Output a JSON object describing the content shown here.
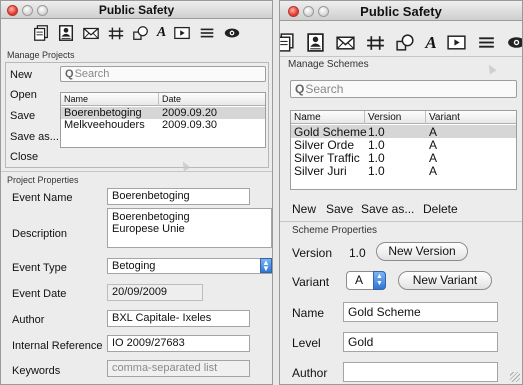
{
  "left_window": {
    "title": "Public Safety",
    "toolbar": [
      {
        "icon": "document-stack-icon"
      },
      {
        "icon": "contact-card-icon"
      },
      {
        "icon": "envelope-icon"
      },
      {
        "icon": "route-icon"
      },
      {
        "icon": "lasso-icon"
      },
      {
        "icon": "text-tool-icon",
        "glyph": "A"
      },
      {
        "icon": "play-box-icon"
      },
      {
        "icon": "list-icon"
      },
      {
        "icon": "eye-icon"
      }
    ],
    "manage_projects": {
      "label": "Manage Projects",
      "buttons": {
        "new": "New",
        "open": "Open",
        "save": "Save",
        "save_as": "Save as...",
        "close": "Close"
      },
      "search_placeholder": "Search",
      "columns": [
        "Name",
        "Date"
      ],
      "rows": [
        {
          "name": "Boerenbetoging",
          "date": "2009.09.20",
          "selected": true
        },
        {
          "name": "Melkveehouders",
          "date": "2009.09.30",
          "selected": false
        }
      ]
    },
    "project_properties": {
      "label": "Project Properties",
      "event_name_label": "Event Name",
      "event_name": "Boerenbetoging",
      "description_label": "Description",
      "description_line1": "Boerenbetoging",
      "description_line2": "Europese Unie",
      "event_type_label": "Event Type",
      "event_type": "Betoging",
      "event_date_label": "Event Date",
      "event_date": "20/09/2009",
      "author_label": "Author",
      "author": "BXL Capitale- Ixeles",
      "internal_reference_label": "Internal Reference",
      "internal_reference": "IO 2009/27683",
      "keywords_label": "Keywords",
      "keywords_placeholder": "comma-separated list"
    }
  },
  "right_window": {
    "title": "Public Safety",
    "manage_schemes": {
      "label": "Manage Schemes",
      "search_placeholder": "Search",
      "columns": [
        "Name",
        "Version",
        "Variant"
      ],
      "rows": [
        {
          "name": "Gold Scheme",
          "version": "1.0",
          "variant": "A",
          "selected": true
        },
        {
          "name": "Silver Orde",
          "version": "1.0",
          "variant": "A",
          "selected": false
        },
        {
          "name": "Silver Traffic",
          "version": "1.0",
          "variant": "A",
          "selected": false
        },
        {
          "name": "Silver Juri",
          "version": "1.0",
          "variant": "A",
          "selected": false
        }
      ],
      "buttons": {
        "new": "New",
        "save": "Save",
        "save_as": "Save as...",
        "delete": "Delete"
      }
    },
    "scheme_properties": {
      "label": "Scheme Properties",
      "version_label": "Version",
      "version": "1.0",
      "new_version_button": "New Version",
      "variant_label": "Variant",
      "variant": "A",
      "new_variant_button": "New Variant",
      "name_label": "Name",
      "name": "Gold Scheme",
      "level_label": "Level",
      "level": "Gold",
      "author_label": "Author",
      "author": ""
    }
  },
  "colors": {
    "close_light": "#e0372a",
    "accent_blue": "#2e76d6",
    "selected_row": "#d6d6d6"
  }
}
